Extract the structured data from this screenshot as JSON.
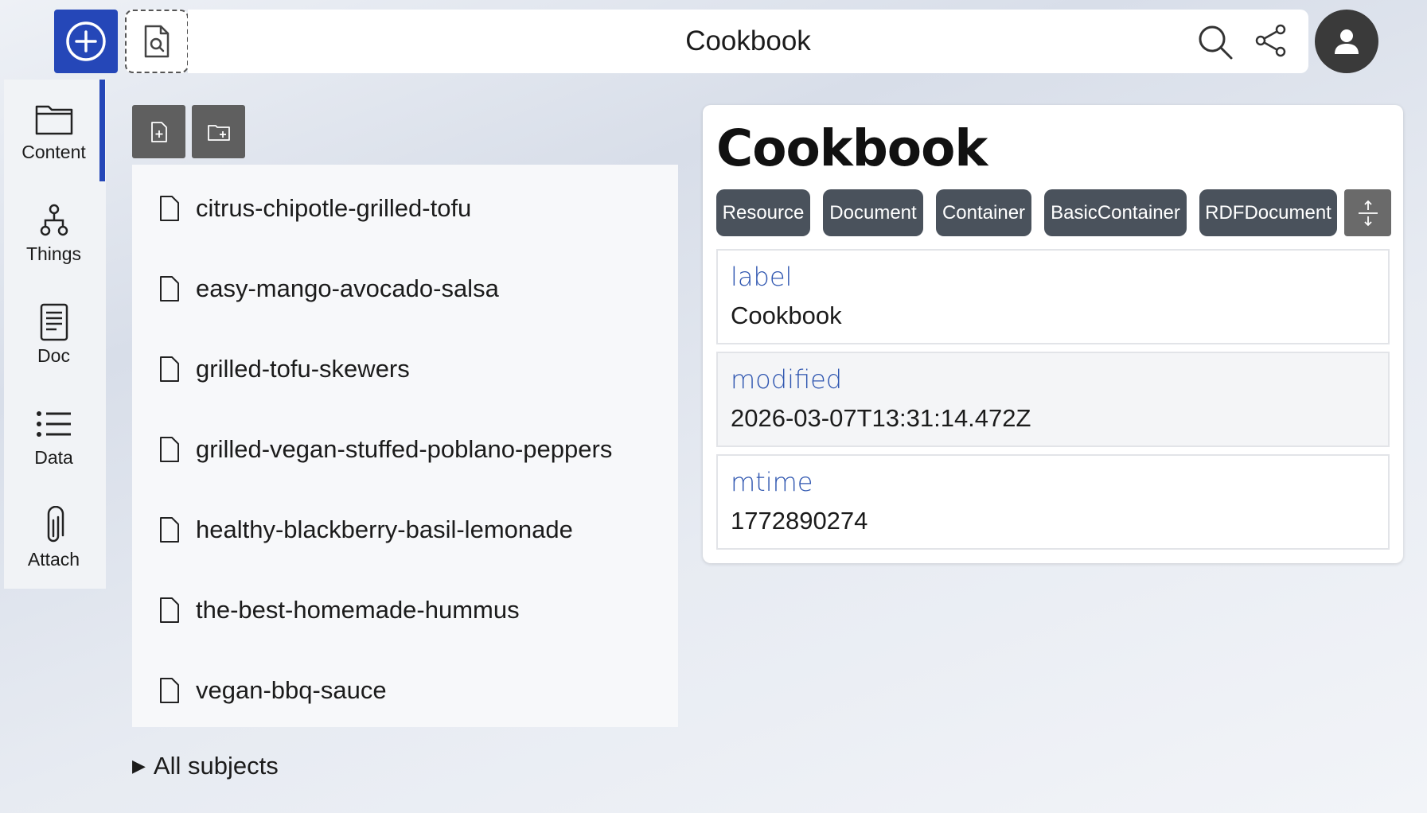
{
  "header": {
    "title": "Cookbook",
    "new_icon": "plus-circle-icon",
    "search_doc_icon": "file-search-icon",
    "search_icon": "search-icon",
    "share_icon": "share-icon",
    "avatar_icon": "user-icon"
  },
  "sidebar": {
    "items": [
      {
        "label": "Content",
        "icon": "folder-icon"
      },
      {
        "label": "Things",
        "icon": "hierarchy-icon"
      },
      {
        "label": "Doc",
        "icon": "document-icon"
      },
      {
        "label": "Data",
        "icon": "list-icon"
      },
      {
        "label": "Attach",
        "icon": "paperclip-icon"
      }
    ],
    "active": "Content"
  },
  "content": {
    "tools": [
      {
        "icon": "file-plus-icon"
      },
      {
        "icon": "folder-plus-icon"
      }
    ],
    "files": [
      "citrus-chipotle-grilled-tofu",
      "easy-mango-avocado-salsa",
      "grilled-tofu-skewers",
      "grilled-vegan-stuffed-poblano-peppers",
      "healthy-blackberry-basil-lemonade",
      "the-best-homemade-hummus",
      "vegan-bbq-sauce"
    ],
    "all_subjects": "All subjects"
  },
  "details": {
    "title": "Cookbook",
    "types": [
      "Resource",
      "Document",
      "Container",
      "BasicContainer",
      "RDFDocument"
    ],
    "expand_icon": "expand-vertical-icon",
    "properties": [
      {
        "key": "label",
        "value": "Cookbook"
      },
      {
        "key": "modified",
        "value": "2026-03-07T13:31:14.472Z"
      },
      {
        "key": "mtime",
        "value": "1772890274"
      }
    ]
  },
  "colors": {
    "accent": "#2547b8",
    "type_button": "#4a525c",
    "property_key": "#2f56b0"
  }
}
